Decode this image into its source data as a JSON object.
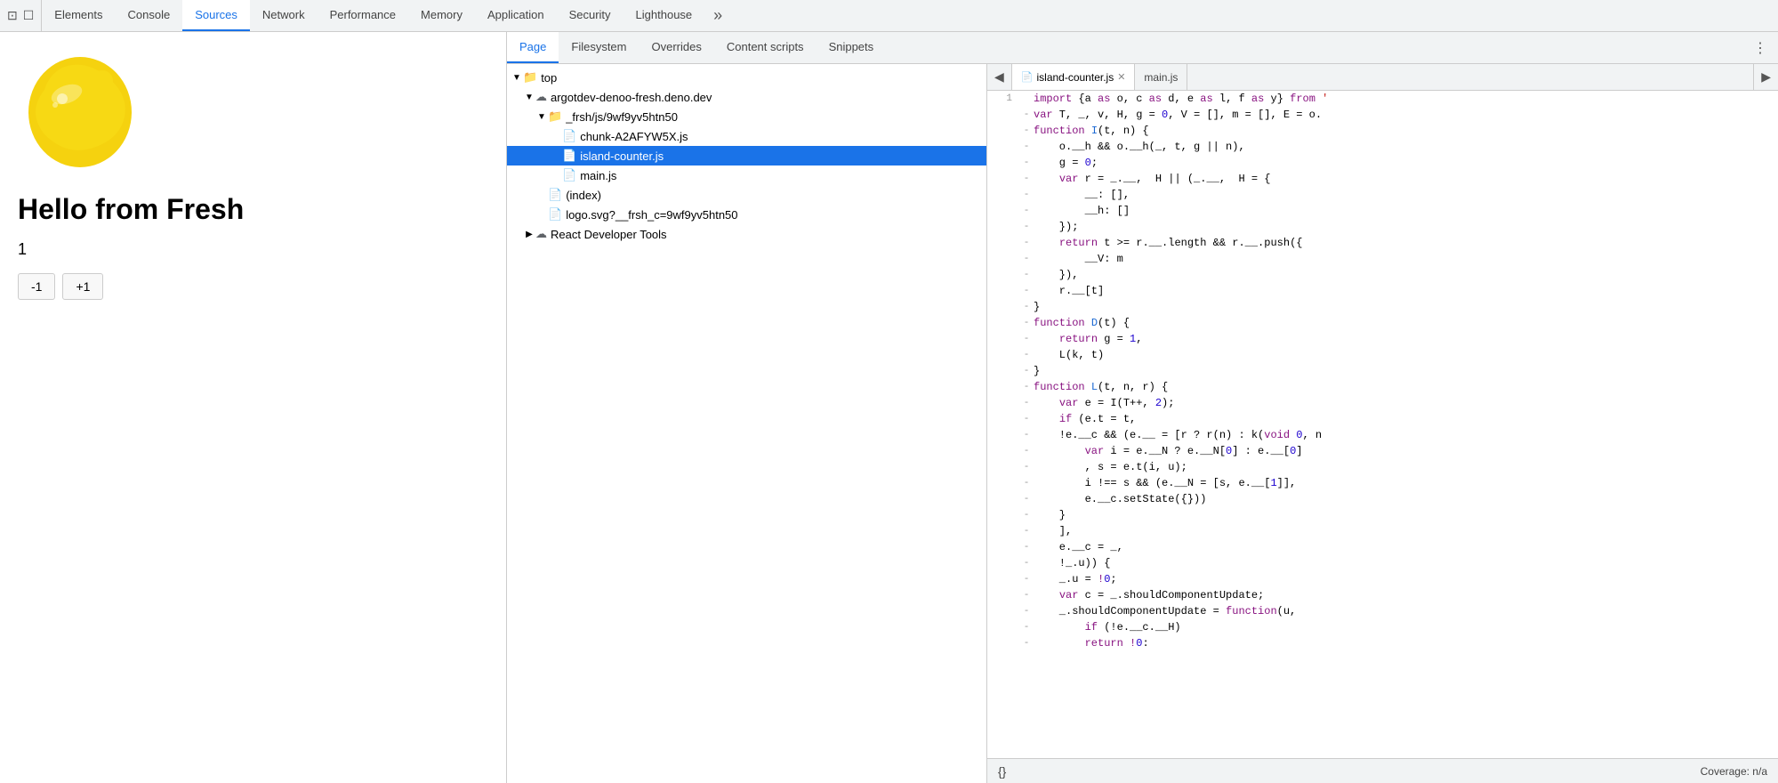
{
  "devtools": {
    "topbar": {
      "icons": [
        "⊡",
        "☐"
      ],
      "tabs": [
        {
          "label": "Elements",
          "active": false
        },
        {
          "label": "Console",
          "active": false
        },
        {
          "label": "Sources",
          "active": true
        },
        {
          "label": "Network",
          "active": false
        },
        {
          "label": "Performance",
          "active": false
        },
        {
          "label": "Memory",
          "active": false
        },
        {
          "label": "Application",
          "active": false
        },
        {
          "label": "Security",
          "active": false
        },
        {
          "label": "Lighthouse",
          "active": false
        }
      ]
    },
    "sources_subtabs": [
      {
        "label": "Page",
        "active": true
      },
      {
        "label": "Filesystem",
        "active": false
      },
      {
        "label": "Overrides",
        "active": false
      },
      {
        "label": "Content scripts",
        "active": false
      },
      {
        "label": "Snippets",
        "active": false
      }
    ],
    "file_tree": {
      "items": [
        {
          "label": "top",
          "indent": 0,
          "type": "folder-open",
          "arrow": "open"
        },
        {
          "label": "argotdev-denoo-fresh.deno.dev",
          "indent": 1,
          "type": "cloud-folder",
          "arrow": "open"
        },
        {
          "label": "_frsh/js/9wf9yv5htn50",
          "indent": 2,
          "type": "folder-open",
          "arrow": "open"
        },
        {
          "label": "chunk-A2AFYW5X.js",
          "indent": 3,
          "type": "file-yellow",
          "arrow": "none"
        },
        {
          "label": "island-counter.js",
          "indent": 3,
          "type": "file-yellow",
          "arrow": "none",
          "selected": true
        },
        {
          "label": "main.js",
          "indent": 3,
          "type": "file-yellow",
          "arrow": "none"
        },
        {
          "label": "(index)",
          "indent": 2,
          "type": "file-gray",
          "arrow": "none"
        },
        {
          "label": "logo.svg?__frsh_c=9wf9yv5htn50",
          "indent": 2,
          "type": "file-green",
          "arrow": "none"
        },
        {
          "label": "React Developer Tools",
          "indent": 1,
          "type": "cloud-folder",
          "arrow": "closed"
        }
      ]
    },
    "code_editor": {
      "tabs": [
        {
          "label": "island-counter.js",
          "active": true,
          "closeable": true
        },
        {
          "label": "main.js",
          "active": false,
          "closeable": false
        }
      ],
      "lines": [
        {
          "num": "1",
          "dash": "",
          "code": [
            {
              "text": "import {a as o, c as d, e as l, f as y} from",
              "class": "kw"
            }
          ]
        },
        {
          "num": "",
          "dash": "-",
          "code": [
            {
              "text": "var T, _, v, H, g = 0, V = [], m = [], E = o.",
              "class": "id"
            }
          ]
        },
        {
          "num": "",
          "dash": "-",
          "code": [
            {
              "text": "function I(t, n) {",
              "class": "id"
            }
          ]
        },
        {
          "num": "",
          "dash": "-",
          "code": [
            {
              "text": "    o.__h && o.__h(_, t, g || n),",
              "class": "id",
              "indent": "    "
            }
          ]
        },
        {
          "num": "",
          "dash": "-",
          "code": [
            {
              "text": "    g = 0;",
              "class": "id",
              "indent": "    "
            }
          ]
        },
        {
          "num": "",
          "dash": "-",
          "code": [
            {
              "text": "    var r = _.__, H || (_.__, H = {",
              "class": "id",
              "indent": "    "
            }
          ]
        },
        {
          "num": "",
          "dash": "-",
          "code": [
            {
              "text": "        __: [],",
              "class": "id",
              "indent": "        "
            }
          ]
        },
        {
          "num": "",
          "dash": "-",
          "code": [
            {
              "text": "        __h: []",
              "class": "id",
              "indent": "        "
            }
          ]
        },
        {
          "num": "",
          "dash": "-",
          "code": [
            {
              "text": "    });",
              "class": "id",
              "indent": "    "
            }
          ]
        },
        {
          "num": "",
          "dash": "-",
          "code": [
            {
              "text": "    return t >= r.__.length && r.__.push({",
              "class": "id",
              "indent": "    "
            }
          ]
        },
        {
          "num": "",
          "dash": "-",
          "code": [
            {
              "text": "        __V: m",
              "class": "id",
              "indent": "        "
            }
          ]
        },
        {
          "num": "",
          "dash": "-",
          "code": [
            {
              "text": "    }),",
              "class": "id",
              "indent": "    "
            }
          ]
        },
        {
          "num": "",
          "dash": "-",
          "code": [
            {
              "text": "    r.__[t]",
              "class": "id",
              "indent": "    "
            }
          ]
        },
        {
          "num": "",
          "dash": "-",
          "code": [
            {
              "text": "}",
              "class": "id"
            }
          ]
        },
        {
          "num": "",
          "dash": "-",
          "code": [
            {
              "text": "function D(t) {",
              "class": "id"
            }
          ]
        },
        {
          "num": "",
          "dash": "-",
          "code": [
            {
              "text": "    return g = 1,",
              "class": "id",
              "indent": "    "
            }
          ]
        },
        {
          "num": "",
          "dash": "-",
          "code": [
            {
              "text": "    L(k, t)",
              "class": "id",
              "indent": "    "
            }
          ]
        },
        {
          "num": "",
          "dash": "-",
          "code": [
            {
              "text": "}",
              "class": "id"
            }
          ]
        },
        {
          "num": "",
          "dash": "-",
          "code": [
            {
              "text": "function L(t, n, r) {",
              "class": "id"
            }
          ]
        },
        {
          "num": "",
          "dash": "-",
          "code": [
            {
              "text": "    var e = I(T++, 2);",
              "class": "id",
              "indent": "    "
            }
          ]
        },
        {
          "num": "",
          "dash": "-",
          "code": [
            {
              "text": "    if (e.t = t,",
              "class": "id",
              "indent": "    "
            }
          ]
        },
        {
          "num": "",
          "dash": "-",
          "code": [
            {
              "text": "    !e.__c && (e.__ = [r ? r(n) : k(void 0, n",
              "class": "id",
              "indent": "    "
            }
          ]
        },
        {
          "num": "",
          "dash": "-",
          "code": [
            {
              "text": "        var i = e.__N ? e.__N[0] : e.__[0]",
              "class": "id",
              "indent": "        "
            }
          ]
        },
        {
          "num": "",
          "dash": "-",
          "code": [
            {
              "text": "        , s = e.t(i, u);",
              "class": "id",
              "indent": "        "
            }
          ]
        },
        {
          "num": "",
          "dash": "-",
          "code": [
            {
              "text": "        i !== s && (e.__N = [s, e.__[1]],",
              "class": "id",
              "indent": "        "
            }
          ]
        },
        {
          "num": "",
          "dash": "-",
          "code": [
            {
              "text": "        e.__c.setState({}))",
              "class": "id",
              "indent": "        "
            }
          ]
        },
        {
          "num": "",
          "dash": "-",
          "code": [
            {
              "text": "    }",
              "class": "id",
              "indent": "    "
            }
          ]
        },
        {
          "num": "",
          "dash": "-",
          "code": [
            {
              "text": "    ],",
              "class": "id",
              "indent": "    "
            }
          ]
        },
        {
          "num": "",
          "dash": "-",
          "code": [
            {
              "text": "    e.__c = _,",
              "class": "id",
              "indent": "    "
            }
          ]
        },
        {
          "num": "",
          "dash": "-",
          "code": [
            {
              "text": "    !_.u)) {",
              "class": "id",
              "indent": "    "
            }
          ]
        },
        {
          "num": "",
          "dash": "-",
          "code": [
            {
              "text": "    _.u = !0;",
              "class": "id",
              "indent": "    "
            }
          ]
        },
        {
          "num": "",
          "dash": "-",
          "code": [
            {
              "text": "    var c = _.shouldComponentUpdate;",
              "class": "id",
              "indent": "    "
            }
          ]
        },
        {
          "num": "",
          "dash": "-",
          "code": [
            {
              "text": "    _.shouldComponentUpdate = function(u,",
              "class": "id",
              "indent": "    "
            }
          ]
        },
        {
          "num": "",
          "dash": "-",
          "code": [
            {
              "text": "        if (!e.__c.__H)",
              "class": "id",
              "indent": "        "
            }
          ]
        },
        {
          "num": "",
          "dash": "-",
          "code": [
            {
              "text": "        return !0:",
              "class": "id",
              "indent": "        "
            }
          ]
        }
      ],
      "footer": {
        "braces": "{}",
        "coverage": "Coverage: n/a"
      }
    }
  },
  "preview": {
    "heading": "Hello from Fresh",
    "counter": "1",
    "buttons": [
      {
        "label": "-1"
      },
      {
        "label": "+1"
      }
    ]
  }
}
